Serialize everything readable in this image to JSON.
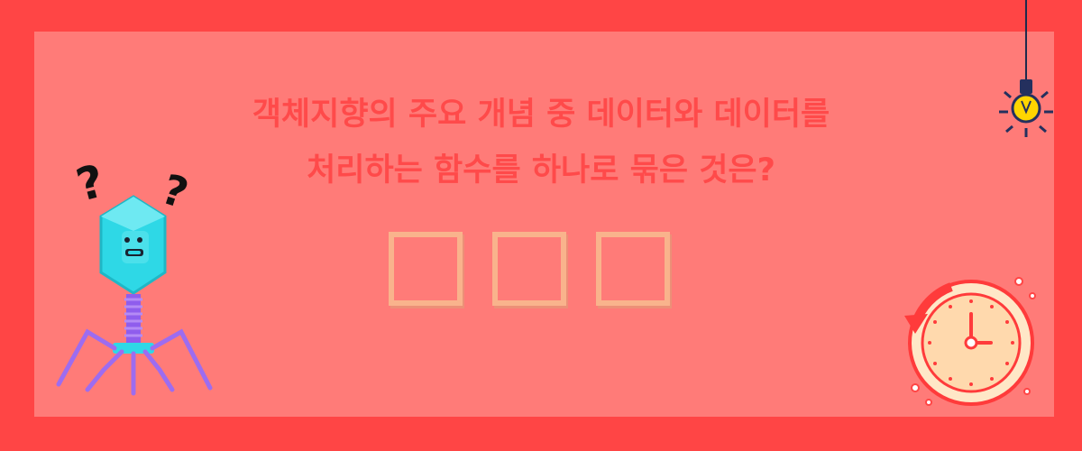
{
  "question": {
    "line1": "객체지향의 주요 개념 중 데이터와 데이터를",
    "line2": "처리하는 함수를 하나로 묶은 것은?"
  },
  "answer_blanks": {
    "count": 3
  },
  "mascot": {
    "left_mark": "?",
    "right_mark": "?"
  },
  "icons": [
    "virus-mascot-icon",
    "lightbulb-icon",
    "clock-history-icon"
  ],
  "colors": {
    "frame": "#ff4545",
    "panel": "#ff7b78",
    "question_text": "#ff4a4a",
    "blank_border": "#f9b38c",
    "mascot_body": "#2ed8e6",
    "mascot_legs": "#9d6cf0"
  }
}
